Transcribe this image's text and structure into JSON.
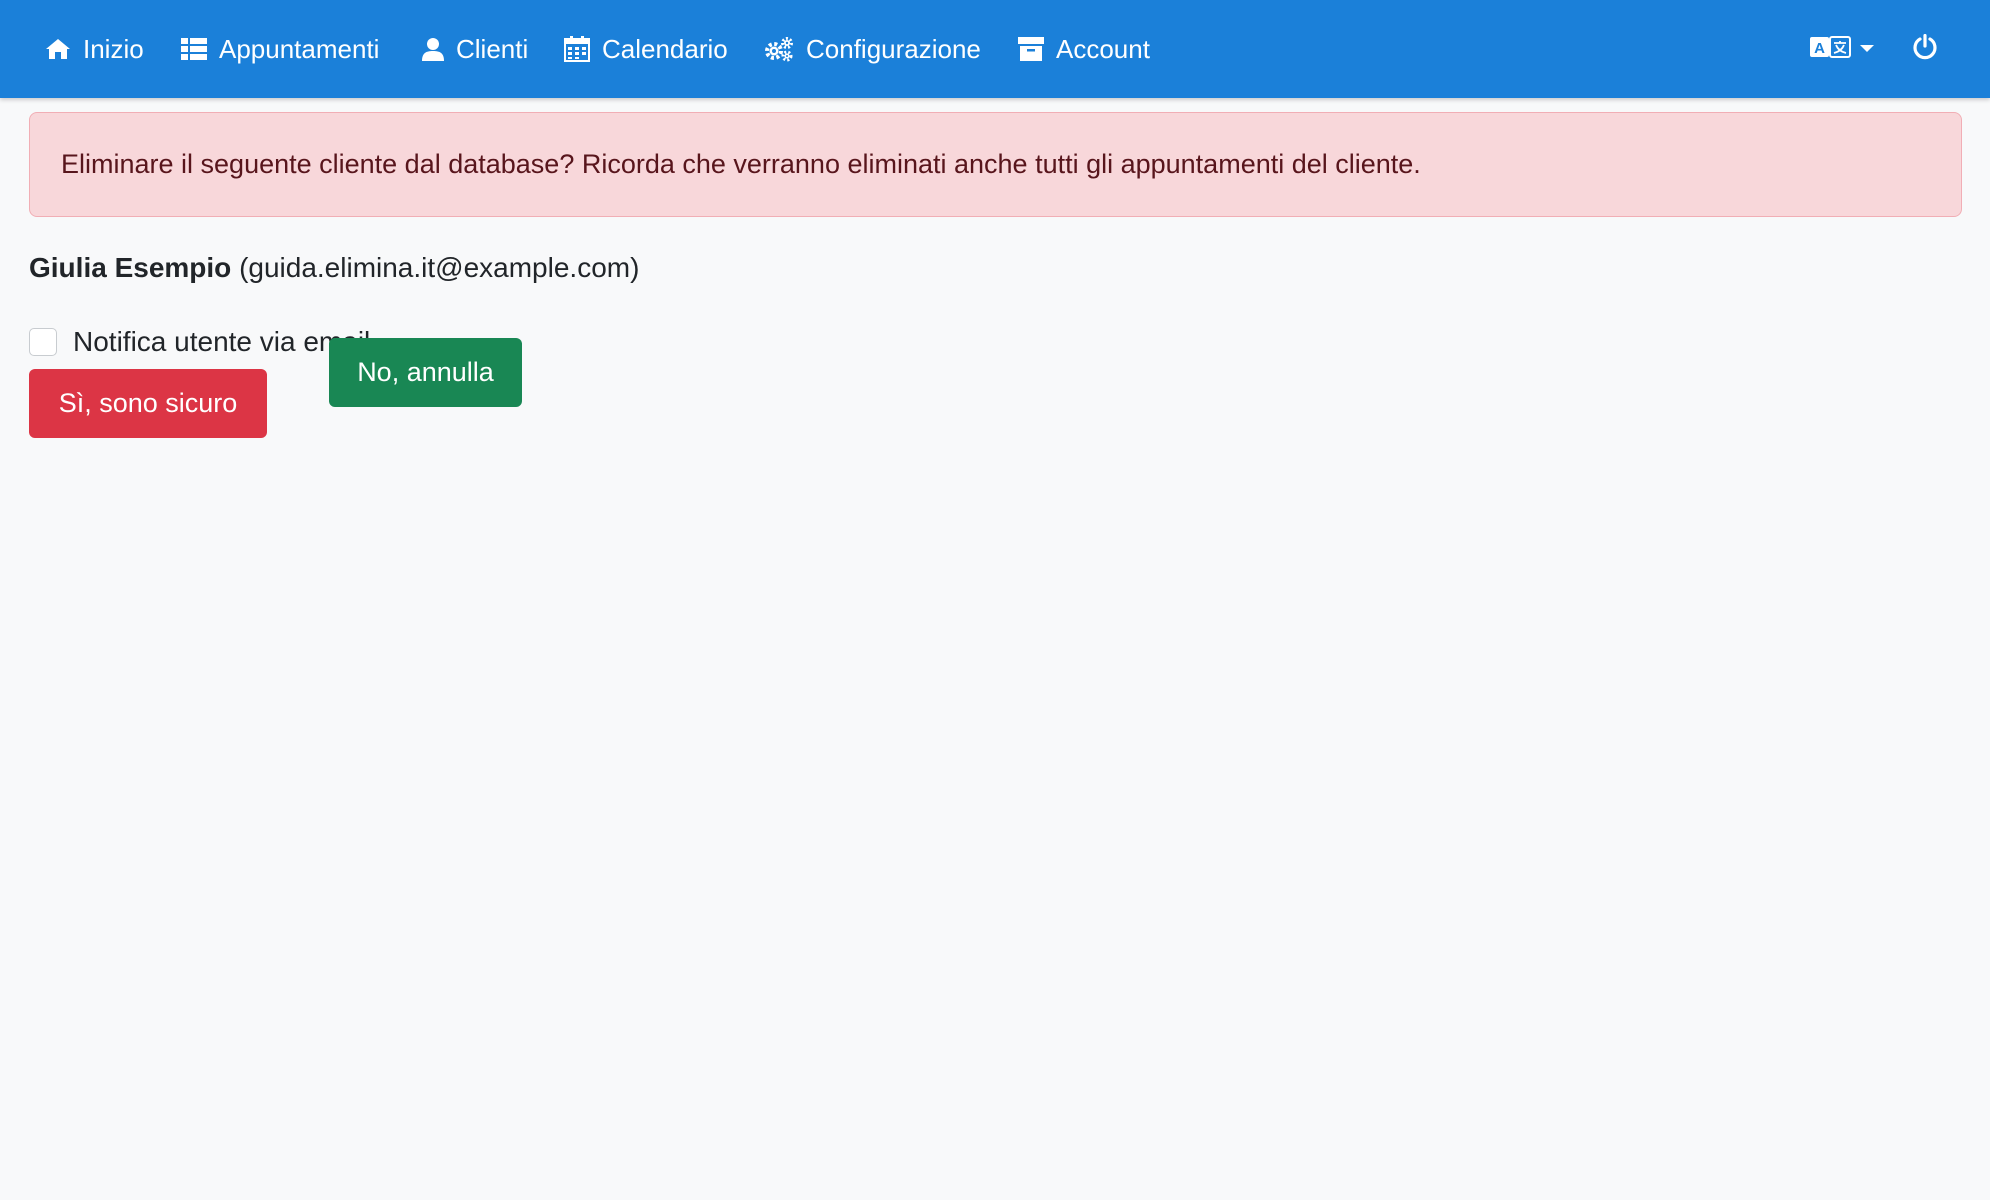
{
  "navbar": {
    "items": [
      {
        "label": "Inizio",
        "icon": "home-icon"
      },
      {
        "label": "Appuntamenti",
        "icon": "list-icon"
      },
      {
        "label": "Clienti",
        "icon": "user-icon"
      },
      {
        "label": "Calendario",
        "icon": "calendar-icon"
      },
      {
        "label": "Configurazione",
        "icon": "cogs-icon"
      },
      {
        "label": "Account",
        "icon": "archive-icon"
      }
    ],
    "language_icon": "language-icon",
    "logout_icon": "power-icon"
  },
  "alert": {
    "message": "Eliminare il seguente cliente dal database? Ricorda che verranno eliminati anche tutti gli appuntamenti del cliente."
  },
  "customer": {
    "name": "Giulia Esempio",
    "email": "(guida.elimina.it@example.com)"
  },
  "notify": {
    "label": "Notifica utente via email",
    "checked": false
  },
  "buttons": {
    "confirm_label": "Sì, sono sicuro",
    "cancel_label": "No, annulla"
  },
  "colors": {
    "navbar": "#1b80d9",
    "alert_bg": "#f8d7da",
    "alert_text": "#58151c",
    "danger": "#dc3545",
    "success": "#198754",
    "background": "#f8f9fa"
  }
}
